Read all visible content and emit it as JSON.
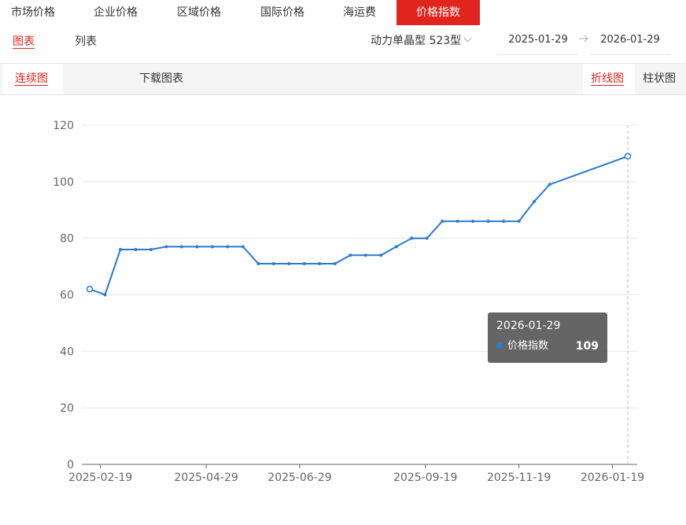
{
  "top_tabs": [
    "市场价格",
    "企业价格",
    "区域价格",
    "国际价格",
    "海运费",
    "价格指数"
  ],
  "sub_tabs": [
    "图表",
    "列表"
  ],
  "model_select": "动力单晶型 523型",
  "date_start": "2025-01-29",
  "date_end": "2026-01-29",
  "toolbar": {
    "continuous": "连续图",
    "download": "下载图表",
    "line_chart": "折线图",
    "bar_chart": "柱状图"
  },
  "colors": {
    "accent": "#e0251f",
    "series": "#2a7ad2"
  },
  "tooltip": {
    "date": "2026-01-29",
    "series_name": "价格指数",
    "value": "109"
  },
  "chart_data": {
    "type": "line",
    "title": "",
    "xlabel": "",
    "ylabel": "",
    "ylim": [
      0,
      120
    ],
    "yticks": [
      0,
      20,
      40,
      60,
      80,
      100,
      120
    ],
    "x_range": [
      "2025-02-12",
      "2026-01-29"
    ],
    "xtick_labels": [
      "2025-02-19",
      "2025-04-29",
      "2025-06-29",
      "2025-09-19",
      "2025-11-19",
      "2026-01-19"
    ],
    "grid": "horizontal",
    "series": [
      {
        "name": "价格指数",
        "points": [
          [
            "2025-02-12",
            62
          ],
          [
            "2025-02-22",
            60
          ],
          [
            "2025-03-04",
            76
          ],
          [
            "2025-03-14",
            76
          ],
          [
            "2025-03-24",
            76
          ],
          [
            "2025-04-03",
            77
          ],
          [
            "2025-04-13",
            77
          ],
          [
            "2025-04-23",
            77
          ],
          [
            "2025-05-03",
            77
          ],
          [
            "2025-05-13",
            77
          ],
          [
            "2025-05-23",
            77
          ],
          [
            "2025-06-02",
            71
          ],
          [
            "2025-06-12",
            71
          ],
          [
            "2025-06-22",
            71
          ],
          [
            "2025-07-02",
            71
          ],
          [
            "2025-07-12",
            71
          ],
          [
            "2025-07-22",
            71
          ],
          [
            "2025-08-01",
            74
          ],
          [
            "2025-08-11",
            74
          ],
          [
            "2025-08-21",
            74
          ],
          [
            "2025-08-31",
            77
          ],
          [
            "2025-09-10",
            80
          ],
          [
            "2025-09-20",
            80
          ],
          [
            "2025-09-30",
            86
          ],
          [
            "2025-10-10",
            86
          ],
          [
            "2025-10-20",
            86
          ],
          [
            "2025-10-30",
            86
          ],
          [
            "2025-11-09",
            86
          ],
          [
            "2025-11-19",
            86
          ],
          [
            "2025-11-29",
            93
          ],
          [
            "2025-12-09",
            99
          ],
          [
            "2026-01-29",
            109
          ]
        ]
      }
    ]
  }
}
